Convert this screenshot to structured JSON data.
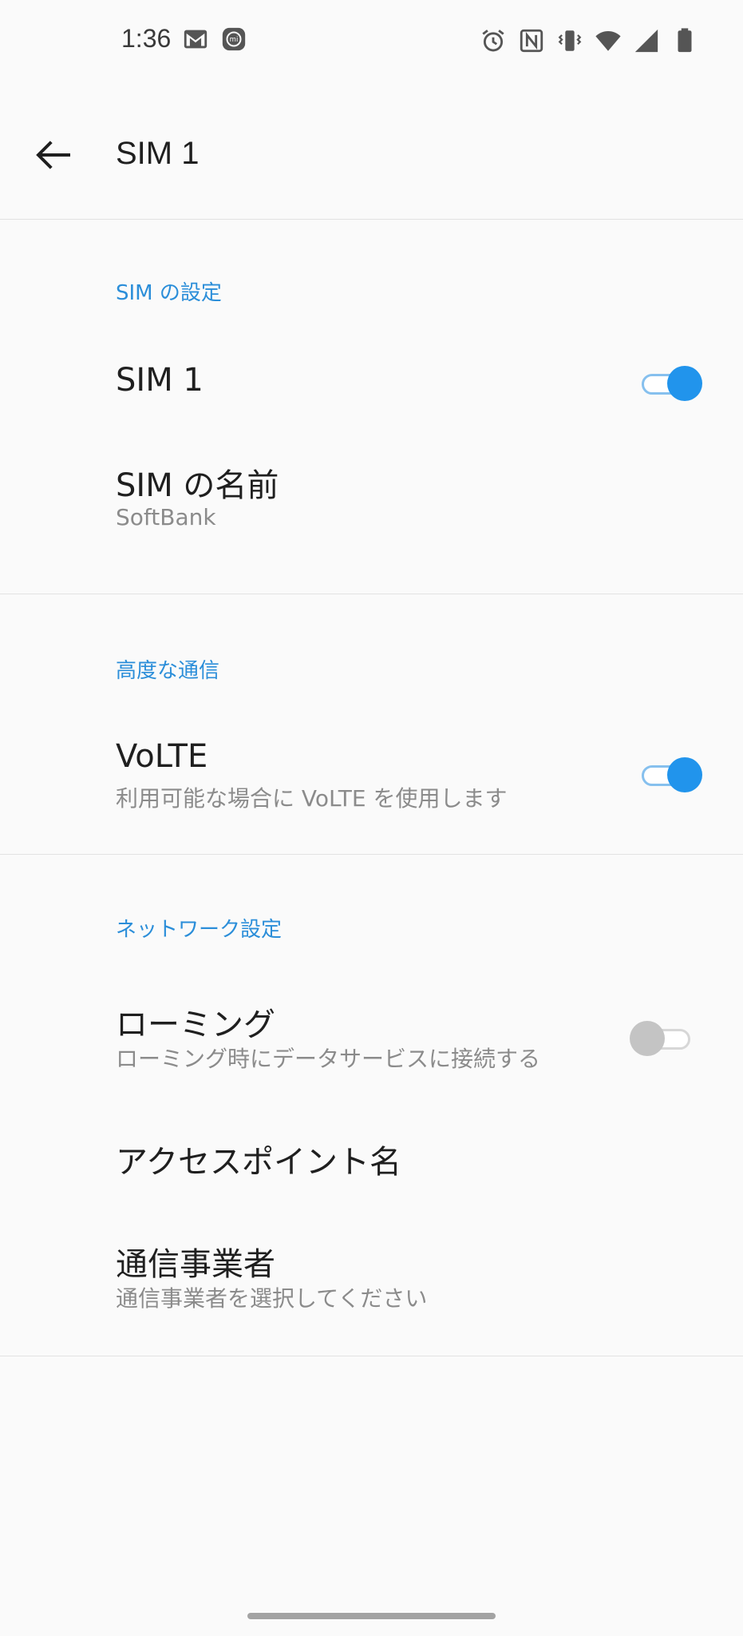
{
  "status_bar": {
    "time": "1:36",
    "left_icons": [
      "gmail-icon",
      "mi-app-icon"
    ],
    "right_icons": [
      "alarm-icon",
      "nfc-icon",
      "vibrate-icon",
      "wifi-icon",
      "signal-icon",
      "battery-icon"
    ]
  },
  "app_bar": {
    "title": "SIM 1",
    "back_icon": "arrow-back-icon"
  },
  "sections": {
    "sim_settings": {
      "header": "SIM の設定",
      "sim_toggle": {
        "title": "SIM 1",
        "enabled": true
      },
      "sim_name": {
        "title": "SIM の名前",
        "summary": "SoftBank"
      }
    },
    "advanced_calling": {
      "header": "高度な通信",
      "volte": {
        "title": "VoLTE",
        "summary": "利用可能な場合に VoLTE を使用します",
        "enabled": true
      }
    },
    "network_settings": {
      "header": "ネットワーク設定",
      "roaming": {
        "title": "ローミング",
        "summary": "ローミング時にデータサービスに接続する",
        "enabled": false
      },
      "apn": {
        "title": "アクセスポイント名"
      },
      "carrier": {
        "title": "通信事業者",
        "summary": "通信事業者を選択してください"
      }
    }
  },
  "colors": {
    "accent": "#2194ec",
    "header_text": "#2b8ed9",
    "background": "#fafafa",
    "divider": "#e2e2e2",
    "summary_text": "#8b8b8b"
  }
}
